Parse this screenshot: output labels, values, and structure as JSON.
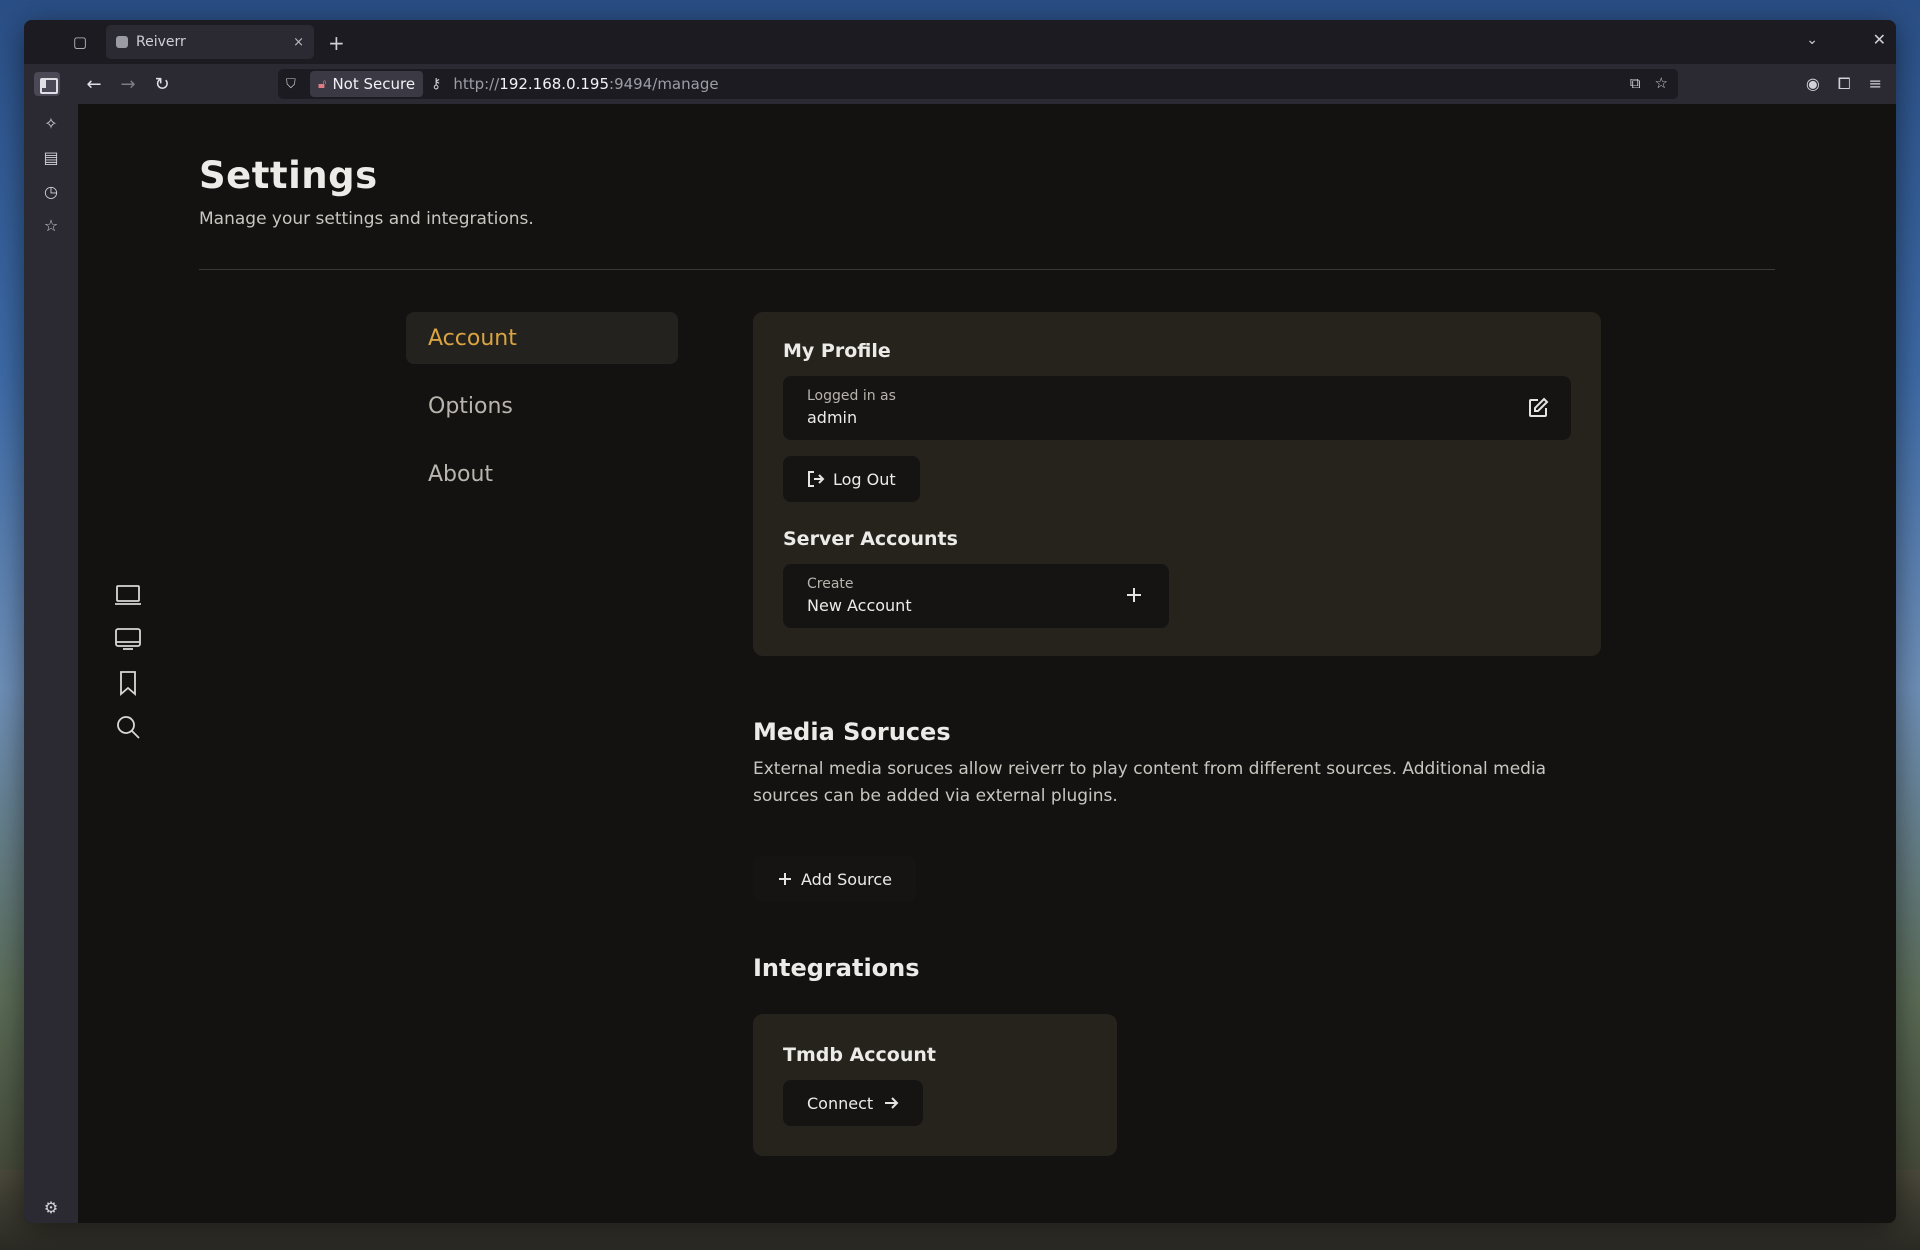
{
  "browser": {
    "tab_title": "Reiverr",
    "tab_close": "×",
    "new_tab": "+",
    "security_label": "Not Secure",
    "url_scheme": "http://",
    "url_host": "192.168.0.195",
    "url_rest": ":9494/manage"
  },
  "page": {
    "title": "Settings",
    "subtitle": "Manage your settings and integrations."
  },
  "settings_nav": {
    "items": [
      {
        "label": "Account",
        "active": true
      },
      {
        "label": "Options",
        "active": false
      },
      {
        "label": "About",
        "active": false
      }
    ]
  },
  "profile": {
    "title": "My Profile",
    "logged_in_label": "Logged in as",
    "username": "admin",
    "logout_label": "Log Out"
  },
  "server_accounts": {
    "title": "Server Accounts",
    "create_label": "Create",
    "new_account_label": "New Account"
  },
  "media_sources": {
    "title": "Media Soruces",
    "description": "External media soruces allow reiverr to play content from different sources. Additional media sources can be added via external plugins.",
    "add_label": "Add Source"
  },
  "integrations": {
    "title": "Integrations",
    "tmdb_title": "Tmdb Account",
    "connect_label": "Connect"
  },
  "colors": {
    "accent": "#d9a441",
    "card_bg": "#26231d",
    "page_bg": "#131211"
  }
}
